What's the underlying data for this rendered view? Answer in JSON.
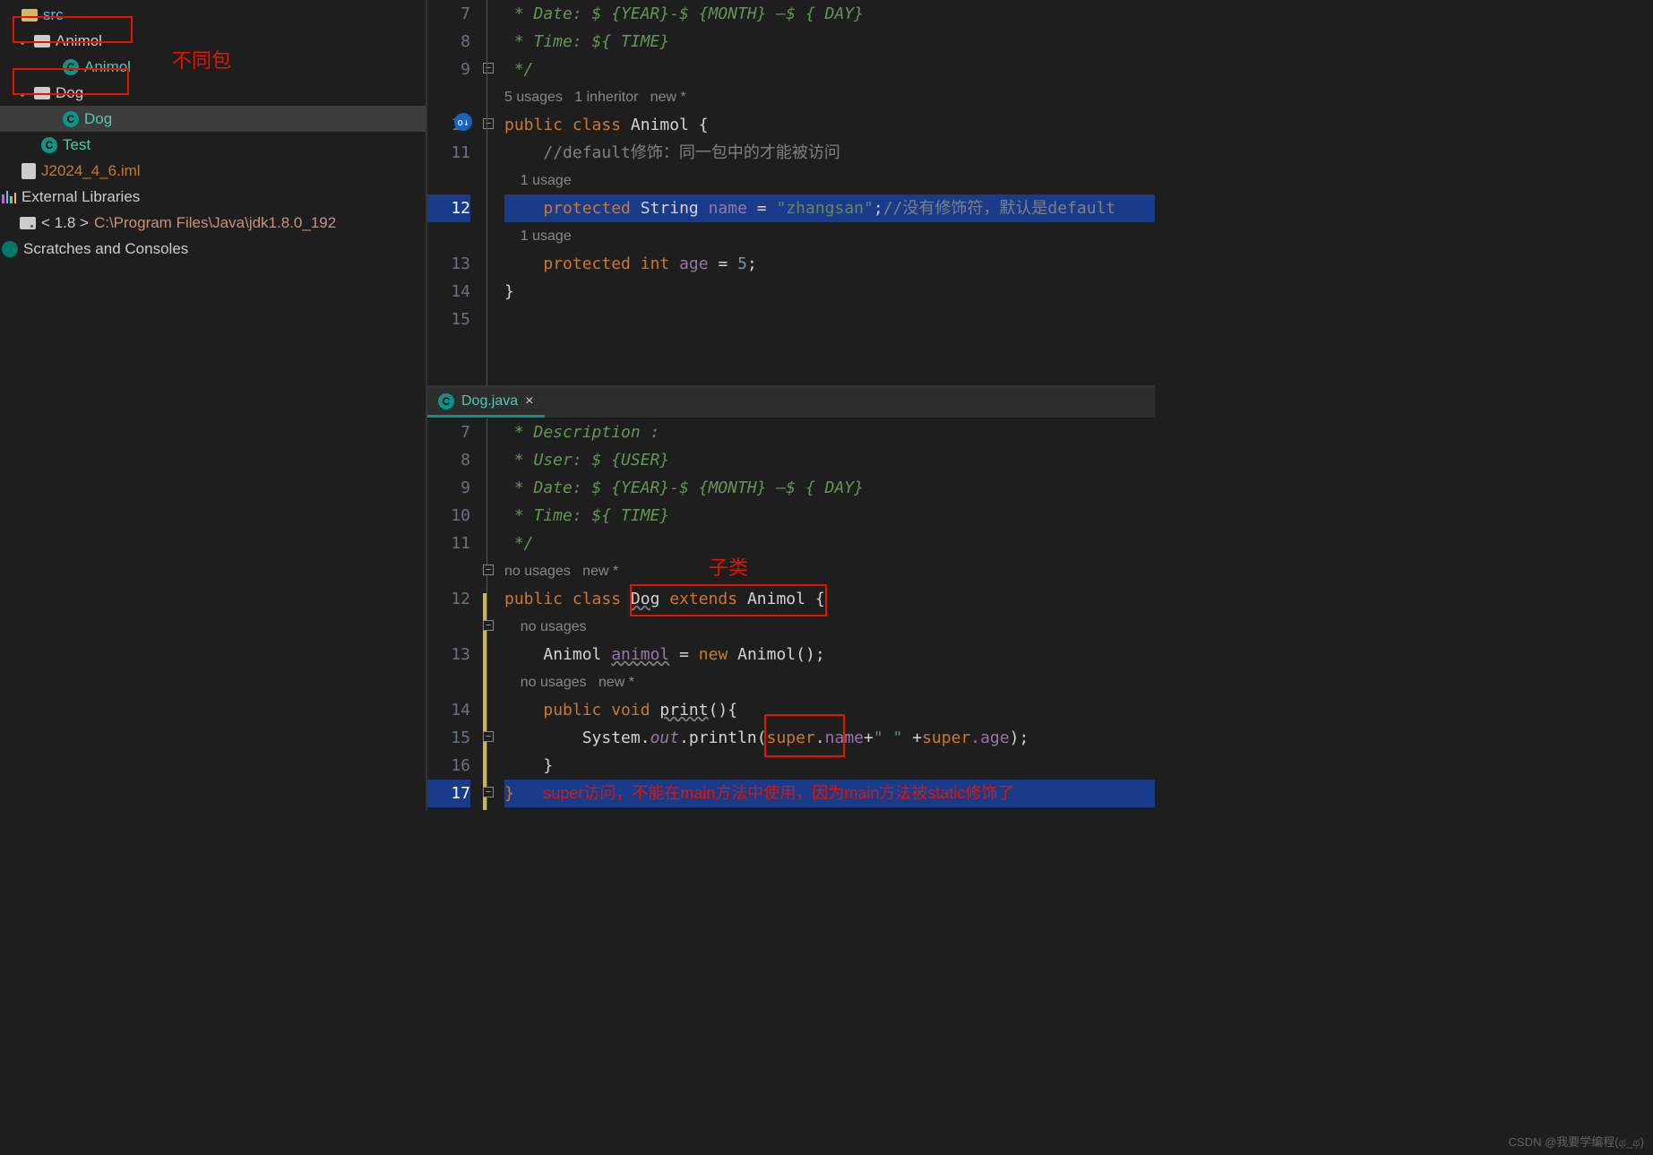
{
  "sidebar": {
    "src_label": "src",
    "animol_folder": "Animol",
    "animol_class": "Animol",
    "dog_folder": "Dog",
    "dog_class": "Dog",
    "test_class": "Test",
    "iml_file": "J2024_4_6.iml",
    "ext_lib": "External Libraries",
    "jdk_prefix": "< 1.8 >",
    "jdk_path": "C:\\Program Files\\Java\\jdk1.8.0_192",
    "scratch": "Scratches and Consoles"
  },
  "annotations": {
    "diff_pkg": "不同包",
    "subclass": "子类",
    "super_note": "super访问，不能在main方法中使用，因为main方法被static修饰了"
  },
  "pane1": {
    "lines": {
      "l7": " * Date: $ {YEAR}-$ {MONTH} —$ { DAY}",
      "l8": " * Time: ${ TIME}",
      "l9": " */",
      "hint_usage": "5 usages   1 inheritor   new *",
      "l10_public": "public ",
      "l10_class": "class ",
      "l10_name": "Animol",
      "l10_brace": " {",
      "l11": "//default修饰：同一包中的才能被访问",
      "hint_1u": "1 usage",
      "l12_prot": "protected ",
      "l12_type": "String ",
      "l12_name": "name",
      "l12_eq": " = ",
      "l12_str": "\"zhangsan\"",
      "l12_semi": ";",
      "l12_com": "//没有修饰符，默认是default",
      "l13_prot": "protected ",
      "l13_type": "int ",
      "l13_name": "age",
      "l13_eq": " = ",
      "l13_val": "5",
      "l13_semi": ";",
      "l14": "}"
    },
    "numbers": [
      "7",
      "8",
      "9",
      "10",
      "11",
      "12",
      "13",
      "14",
      "15"
    ]
  },
  "pane2": {
    "tab_name": "Dog.java",
    "lines": {
      "l7": " * Description :",
      "l8": " * User: $ {USER}",
      "l9": " * Date: $ {YEAR}-$ {MONTH} —$ { DAY}",
      "l10": " * Time: ${ TIME}",
      "l11": " */",
      "hint_nu": "no usages   new *",
      "l12_public": "public ",
      "l12_class": "class ",
      "l12_dog": "Dog",
      "l12_ext": " extends ",
      "l12_ani": "Animol",
      "l12_brace": " {",
      "hint_nou": "no usages",
      "l13_type": "Animol ",
      "l13_var": "animol",
      "l13_eq": " = ",
      "l13_new": "new ",
      "l13_ani": "Animol",
      "l13_end": "();",
      "l14_public": "public ",
      "l14_void": "void ",
      "l14_name": "print",
      "l14_end": "(){",
      "l15_sys": "System.",
      "l15_out": "out",
      "l15_pr": ".println(",
      "l15_sup1": "super",
      "l15_dot": ".",
      "l15_name": "name",
      "l15_plus": "+",
      "l15_sp": "\" \"",
      "l15_plus2": " +",
      "l15_sup2": "super",
      "l15_age": ".age",
      "l15_end": ");",
      "l16": "}",
      "l17": "}"
    },
    "numbers": [
      "7",
      "8",
      "9",
      "10",
      "11",
      "12",
      "13",
      "14",
      "15",
      "16",
      "17"
    ]
  },
  "watermark": "CSDN @我要学编程(ಥ_ಥ)"
}
